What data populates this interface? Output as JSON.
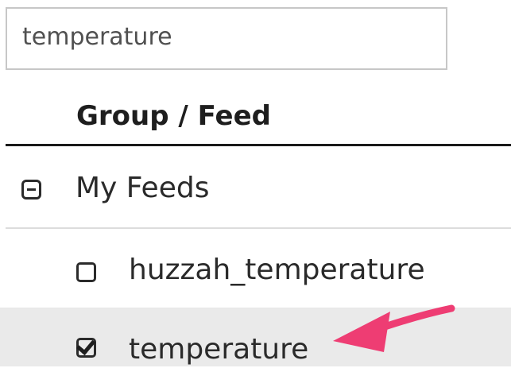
{
  "search": {
    "value": "temperature"
  },
  "table": {
    "header": "Group / Feed",
    "group": {
      "label": "My Feeds",
      "expanded": true
    },
    "feeds": [
      {
        "label": "huzzah_temperature",
        "checked": false
      },
      {
        "label": "temperature",
        "checked": true
      }
    ]
  },
  "annotation": {
    "arrow_color": "#ee3d73"
  }
}
